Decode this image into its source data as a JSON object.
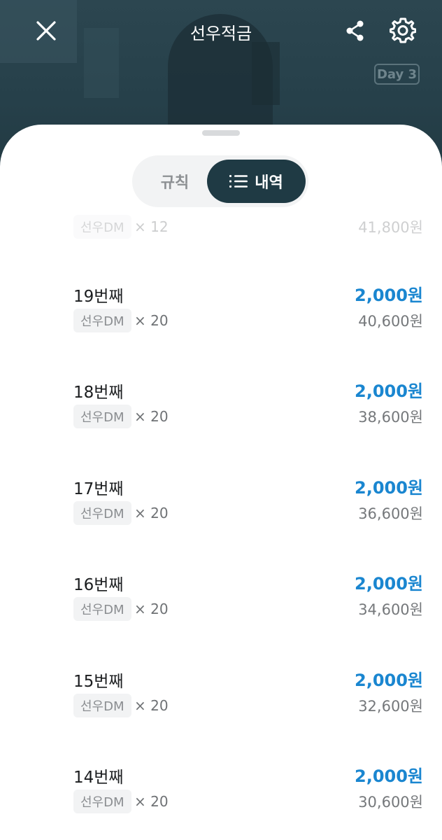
{
  "header": {
    "title": "선우적금",
    "day_badge": "Day 3",
    "icons": {
      "close": "close-icon",
      "share": "share-icon",
      "settings": "gear-icon"
    }
  },
  "tabs": {
    "rules_label": "규칙",
    "history_label": "내역",
    "active": "history"
  },
  "colors": {
    "accent": "#1a86d0",
    "dark_teal": "#1f3a44"
  },
  "partial_row": {
    "tag": "선우DM",
    "multiplier": "× 12",
    "total": "41,800원"
  },
  "history": [
    {
      "title": "19번째",
      "tag": "선우DM",
      "multiplier": "× 20",
      "amount": "2,000원",
      "total": "40,600원"
    },
    {
      "title": "18번째",
      "tag": "선우DM",
      "multiplier": "× 20",
      "amount": "2,000원",
      "total": "38,600원"
    },
    {
      "title": "17번째",
      "tag": "선우DM",
      "multiplier": "× 20",
      "amount": "2,000원",
      "total": "36,600원"
    },
    {
      "title": "16번째",
      "tag": "선우DM",
      "multiplier": "× 20",
      "amount": "2,000원",
      "total": "34,600원"
    },
    {
      "title": "15번째",
      "tag": "선우DM",
      "multiplier": "× 20",
      "amount": "2,000원",
      "total": "32,600원"
    },
    {
      "title": "14번째",
      "tag": "선우DM",
      "multiplier": "× 20",
      "amount": "2,000원",
      "total": "30,600원"
    }
  ]
}
